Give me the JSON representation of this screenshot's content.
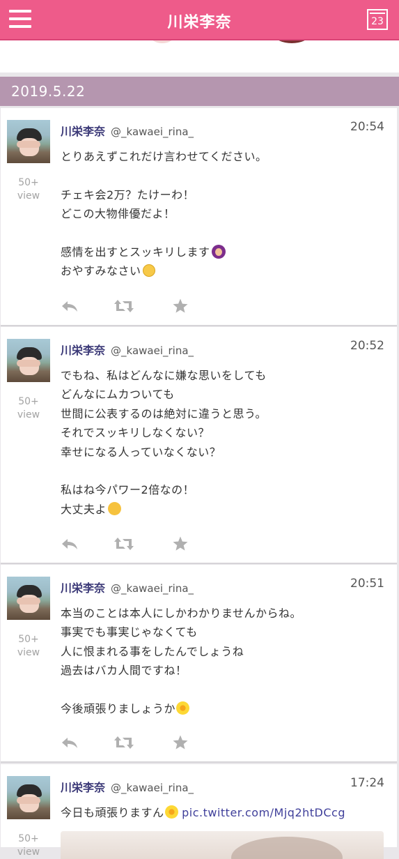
{
  "header": {
    "title": "川栄李奈",
    "calendar_day": "23"
  },
  "date_bar": {
    "date": "2019.5.22"
  },
  "tweets": [
    {
      "name": "川栄李奈",
      "handle": "@_kawaei_rina_",
      "time": "20:54",
      "views": "50+",
      "views_label": "view",
      "lines": [
        "とりあえずこれだけ言わせてください。",
        "",
        "チェキ会2万？たけーわ！",
        "どこの大物俳優だよ！",
        "",
        "感情を出すとスッキリします",
        "おやすみなさい"
      ],
      "emojis": [
        "person-gesturing-emoji",
        "smiling-face-emoji"
      ]
    },
    {
      "name": "川栄李奈",
      "handle": "@_kawaei_rina_",
      "time": "20:52",
      "views": "50+",
      "views_label": "view",
      "lines": [
        "でもね、私はどんなに嫌な思いをしても",
        "どんなにムカついても",
        "世間に公表するのは絶対に違うと思う。",
        "それでスッキリしなくない？",
        "幸せになる人っていなくない？",
        "",
        "私はね今パワー2倍なの！",
        "大丈夫よ"
      ],
      "emojis": [
        "kissing-face-emoji"
      ]
    },
    {
      "name": "川栄李奈",
      "handle": "@_kawaei_rina_",
      "time": "20:51",
      "views": "50+",
      "views_label": "view",
      "lines": [
        "本当のことは本人にしかわかりませんからね。",
        "事実でも事実じゃなくても",
        "人に恨まれる事をしたんでしょうね",
        "過去はバカ人間ですね！",
        "",
        "今後頑張りましょうか"
      ],
      "emojis": [
        "blossom-emoji"
      ]
    },
    {
      "name": "川栄李奈",
      "handle": "@_kawaei_rina_",
      "time": "17:24",
      "views": "50+",
      "views_label": "view",
      "text": "今日も頑張りますん",
      "link": "pic.twitter.com/Mjq2htDCcg",
      "emojis": [
        "blossom-emoji"
      ]
    }
  ],
  "actions": [
    "reply-icon",
    "retweet-icon",
    "favorite-icon"
  ],
  "colors": {
    "header_bg": "#ee5b8a",
    "date_bar_bg": "#b596af",
    "name_color": "#3c3a78",
    "action_icon": "#b0b0b0"
  }
}
